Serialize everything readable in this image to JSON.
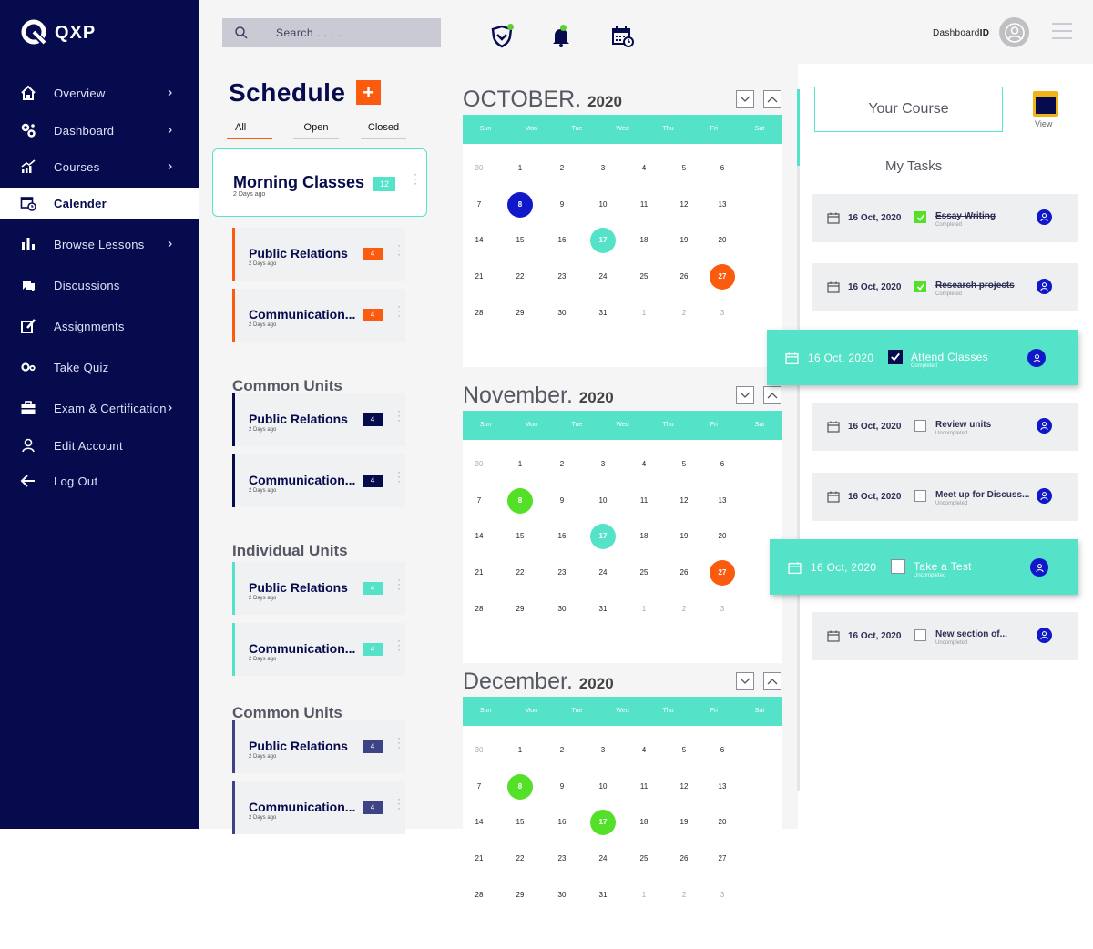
{
  "brand": {
    "name": "QXP"
  },
  "sidebar": {
    "items": [
      {
        "label": "Overview",
        "icon": "home-icon",
        "chevron": true
      },
      {
        "label": "Dashboard",
        "icon": "gears-icon",
        "chevron": true
      },
      {
        "label": "Courses",
        "icon": "growth-chart-icon",
        "chevron": true
      },
      {
        "label": "Calender",
        "icon": "calendar-clock-icon",
        "chevron": false,
        "active": true
      },
      {
        "label": "Browse Lessons",
        "icon": "bar-chart-icon",
        "chevron": true
      },
      {
        "label": "Discussions",
        "icon": "chat-bubbles-icon",
        "chevron": false
      },
      {
        "label": "Assignments",
        "icon": "edit-icon",
        "chevron": false
      },
      {
        "label": "Take Quiz",
        "icon": "settings-icon",
        "chevron": false
      },
      {
        "label": "Exam & Certification",
        "icon": "briefcase-icon",
        "chevron": true
      },
      {
        "label": "Edit Account",
        "icon": "user-icon",
        "chevron": false
      },
      {
        "label": "Log Out",
        "icon": "arrow-left-icon",
        "chevron": false
      }
    ]
  },
  "topbar": {
    "search_placeholder": "Search . . . .",
    "dashboard_prefix": "Dashboard",
    "dashboard_suffix": "ID",
    "icons": [
      "shield-icon",
      "bell-icon",
      "calendar-icon",
      "avatar-icon",
      "menu-icon"
    ]
  },
  "schedule": {
    "title": "Schedule",
    "add_label": "+",
    "tabs": [
      "All",
      "Open",
      "Closed"
    ],
    "main": {
      "title": "Morning Classes",
      "sub": "2 Days ago",
      "count": "12"
    },
    "groups": [
      {
        "heading": "",
        "color": "#fa5b0f",
        "items": [
          {
            "title": "Public Relations",
            "sub": "2 Days ago",
            "count": "4"
          },
          {
            "title": "Communication...",
            "sub": "2 Days ago",
            "count": "4"
          }
        ]
      },
      {
        "heading": "Common Units",
        "color": "#060b4d",
        "items": [
          {
            "title": "Public Relations",
            "sub": "2 Days ago",
            "count": "4"
          },
          {
            "title": "Communication...",
            "sub": "2 Days ago",
            "count": "4"
          }
        ]
      },
      {
        "heading": "Individual Units",
        "color": "#54e2c8",
        "items": [
          {
            "title": "Public Relations",
            "sub": "2 Days ago",
            "count": "4"
          },
          {
            "title": "Communication...",
            "sub": "2 Days ago",
            "count": "4"
          }
        ]
      },
      {
        "heading": "Common Units",
        "color": "#3e4386",
        "items": [
          {
            "title": "Public Relations",
            "sub": "2 Days ago",
            "count": "4"
          },
          {
            "title": "Communication...",
            "sub": "2 Days ago",
            "count": "4"
          }
        ]
      }
    ]
  },
  "calendar": {
    "weekdays": [
      "Sun",
      "Mon",
      "Tue",
      "Wed",
      "Thu",
      "Fri",
      "Sat"
    ],
    "months": [
      {
        "name": "OCTOBER.",
        "year": "2020",
        "highlights": {
          "8": "blue",
          "17": "teal",
          "27": "orange"
        }
      },
      {
        "name": "November.",
        "year": "2020",
        "highlights": {
          "8": "green",
          "17": "teal",
          "27": "orange"
        }
      },
      {
        "name": "December.",
        "year": "2020",
        "highlights": {
          "8": "green",
          "17": "green"
        }
      }
    ],
    "weeks": [
      [
        [
          "30",
          1
        ],
        [
          "1",
          0
        ],
        [
          "2",
          0
        ],
        [
          "3",
          0
        ],
        [
          "4",
          0
        ],
        [
          "5",
          0
        ],
        [
          "6",
          0
        ]
      ],
      [
        [
          "7",
          0
        ],
        [
          "8",
          0
        ],
        [
          "9",
          0
        ],
        [
          "10",
          0
        ],
        [
          "11",
          0
        ],
        [
          "12",
          0
        ],
        [
          "13",
          0
        ]
      ],
      [
        [
          "14",
          0
        ],
        [
          "15",
          0
        ],
        [
          "16",
          0
        ],
        [
          "17",
          0
        ],
        [
          "18",
          0
        ],
        [
          "19",
          0
        ],
        [
          "20",
          0
        ]
      ],
      [
        [
          "21",
          0
        ],
        [
          "22",
          0
        ],
        [
          "23",
          0
        ],
        [
          "24",
          0
        ],
        [
          "25",
          0
        ],
        [
          "26",
          0
        ],
        [
          "27",
          0
        ]
      ],
      [
        [
          "28",
          0
        ],
        [
          "29",
          0
        ],
        [
          "30",
          0
        ],
        [
          "31",
          0
        ],
        [
          "1",
          1
        ],
        [
          "2",
          1
        ],
        [
          "3",
          1
        ]
      ]
    ]
  },
  "right": {
    "your_course": "Your Course",
    "view_label": "View",
    "my_tasks": "My Tasks",
    "tasks": [
      {
        "date": "16 Oct, 2020",
        "name": "Essay Writing",
        "status": "Completed",
        "checked": true,
        "big": false
      },
      {
        "date": "16 Oct, 2020",
        "name": "Research projects",
        "status": "Completed",
        "checked": true,
        "big": false
      },
      {
        "date": "16 Oct, 2020",
        "name": "Attend Classes",
        "status": "Completed",
        "checked": true,
        "big": true
      },
      {
        "date": "16 Oct, 2020",
        "name": "Review units",
        "status": "Uncompleted",
        "checked": false,
        "big": false
      },
      {
        "date": "16 Oct, 2020",
        "name": "Meet up for Discuss...",
        "status": "Uncompleted",
        "checked": false,
        "big": false
      },
      {
        "date": "16 Oct, 2020",
        "name": "Take a Test",
        "status": "Uncompleted",
        "checked": false,
        "big": true
      },
      {
        "date": "16 Oct, 2020",
        "name": "New section of...",
        "status": "Uncompleted",
        "checked": false,
        "big": false
      }
    ]
  },
  "colors": {
    "navy": "#060b4d",
    "teal": "#54e2c8",
    "orange": "#fa5b0f",
    "blue": "#1018c9",
    "green": "#54e029"
  }
}
